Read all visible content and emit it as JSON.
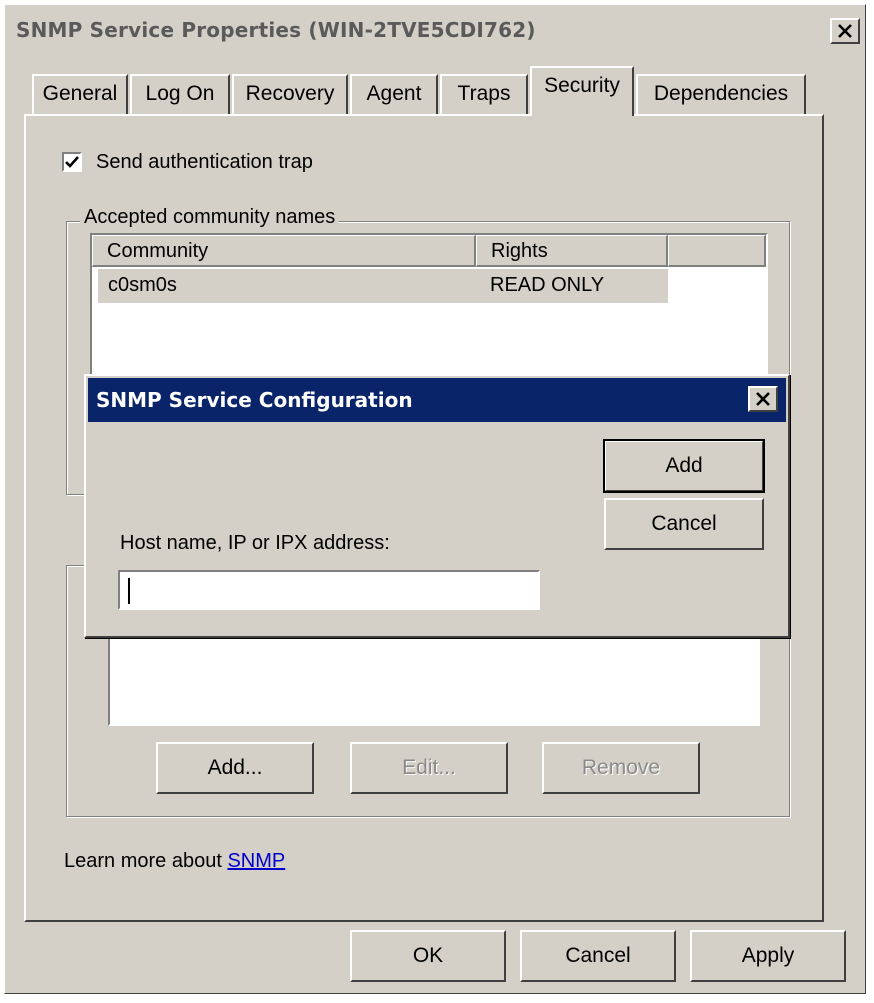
{
  "window": {
    "title": "SNMP Service Properties (WIN-2TVE5CDI762)",
    "close_glyph": "close-icon"
  },
  "tabs": [
    {
      "label": "General",
      "active": false
    },
    {
      "label": "Log On",
      "active": false
    },
    {
      "label": "Recovery",
      "active": false
    },
    {
      "label": "Agent",
      "active": false
    },
    {
      "label": "Traps",
      "active": false
    },
    {
      "label": "Security",
      "active": true
    },
    {
      "label": "Dependencies",
      "active": false
    }
  ],
  "security": {
    "send_auth_trap_label": "Send authentication trap",
    "send_auth_trap_checked": true,
    "community_group_label": "Accepted community names",
    "columns": [
      "Community",
      "Rights"
    ],
    "rows": [
      {
        "community": "c0sm0s",
        "rights": "READ ONLY"
      }
    ],
    "host_buttons": {
      "add": "Add...",
      "edit": "Edit...",
      "remove": "Remove"
    },
    "learn_more_prefix": "Learn more about ",
    "learn_more_link": "SNMP"
  },
  "footer": {
    "ok": "OK",
    "cancel": "Cancel",
    "apply": "Apply"
  },
  "dialog": {
    "title": "SNMP Service Configuration",
    "add": "Add",
    "cancel": "Cancel",
    "host_label": "Host name, IP or IPX address:",
    "host_value": ""
  },
  "colors": {
    "face": "#d4d0c8",
    "dialog_title_bg": "#0a246a",
    "link": "#0000cc"
  }
}
